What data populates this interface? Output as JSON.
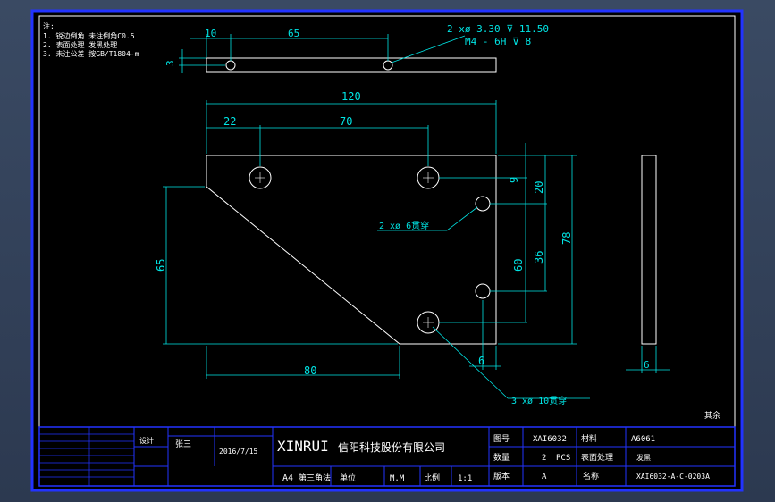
{
  "notes": {
    "header": "注:",
    "lines": [
      "1. 锐边倒角 未注倒角C0.5",
      "2. 表面处理 发黑处理",
      "3. 未注公差 按GB/T1804-m"
    ]
  },
  "top_view": {
    "dim_10": "10",
    "dim_65": "65",
    "dim_3": "3",
    "hole_callout_1": "2 xø 3.30 ⊽ 11.50",
    "hole_callout_2": "M4 - 6H ⊽ 8"
  },
  "front_view": {
    "dim_120": "120",
    "dim_22": "22",
    "dim_70": "70",
    "dim_65": "65",
    "dim_80": "80",
    "dim_9": "9",
    "dim_20": "20",
    "dim_36": "36",
    "dim_60": "60",
    "dim_78": "78",
    "dim_6": "6",
    "hole_callout_small": "2 xø 6贯穿",
    "hole_callout_large": "3 xø 10贯穿"
  },
  "side_view": {
    "dim_6": "6"
  },
  "roughness_note": "其余",
  "title_block": {
    "company_en": "XINRUI",
    "company_cn": "信阳科技股份有限公司",
    "designer_label": "设计",
    "designer": "张三",
    "date": "2016/7/15",
    "drawing_no_label": "图号",
    "drawing_no": "XAI6032",
    "material_label": "材料",
    "material": "A6061",
    "qty_label": "数量",
    "qty": "2",
    "qty_unit": "PCS",
    "surface_label": "表面处理",
    "surface": "发黑",
    "name_label": "名称",
    "part_no": "XAI6032-A-C-0203A",
    "sheet_size": "A4",
    "sheet_note": "第三角法",
    "unit_label": "单位",
    "unit": "M.M",
    "scale_label": "比例",
    "scale": "1:1",
    "revision_label": "版本",
    "revision": "A"
  },
  "colors": {
    "paper": "#000000",
    "frame": "#ffffff",
    "dim": "#00e5e5",
    "blue": "#2233ff"
  }
}
